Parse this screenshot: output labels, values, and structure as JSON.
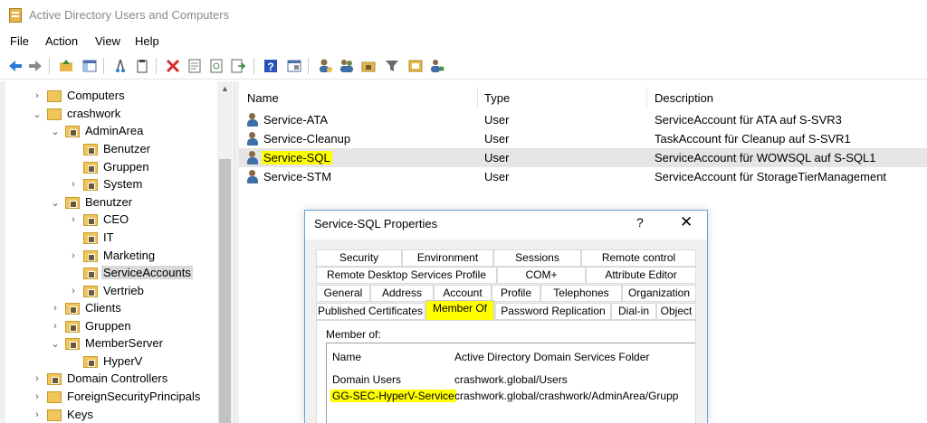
{
  "window": {
    "title": "Active Directory Users and Computers",
    "icon": "aduc-icon"
  },
  "menu": [
    "File",
    "Action",
    "View",
    "Help"
  ],
  "toolbar": {
    "icons": [
      "back-icon",
      "forward-icon",
      "up-folder-icon",
      "show-tree-icon",
      "cut-icon",
      "copy-icon",
      "delete-icon",
      "properties-icon",
      "refresh-icon",
      "export-icon",
      "help-icon",
      "console-icon",
      "new-user-icon",
      "new-group-icon",
      "new-ou-icon",
      "filter-icon",
      "add-to-group-icon",
      "delegate-icon"
    ]
  },
  "tree": {
    "items": [
      {
        "label": "Computers",
        "chevron": "›",
        "folder": "plain"
      },
      {
        "label": "crashwork",
        "chevron": "⌄",
        "folder": "plain"
      },
      {
        "label": "AdminArea",
        "chevron": "⌄",
        "folder": "ou"
      },
      {
        "label": "Benutzer",
        "chevron": "",
        "folder": "ou"
      },
      {
        "label": "Gruppen",
        "chevron": "",
        "folder": "ou"
      },
      {
        "label": "System",
        "chevron": "›",
        "folder": "ou"
      },
      {
        "label": "Benutzer",
        "chevron": "⌄",
        "folder": "ou"
      },
      {
        "label": "CEO",
        "chevron": "›",
        "folder": "ou"
      },
      {
        "label": "IT",
        "chevron": "",
        "folder": "ou"
      },
      {
        "label": "Marketing",
        "chevron": "›",
        "folder": "ou"
      },
      {
        "label": "ServiceAccounts",
        "chevron": "",
        "folder": "ou",
        "selected": true
      },
      {
        "label": "Vertrieb",
        "chevron": "›",
        "folder": "ou"
      },
      {
        "label": "Clients",
        "chevron": "›",
        "folder": "ou"
      },
      {
        "label": "Gruppen",
        "chevron": "›",
        "folder": "ou"
      },
      {
        "label": "MemberServer",
        "chevron": "⌄",
        "folder": "ou"
      },
      {
        "label": "HyperV",
        "chevron": "",
        "folder": "ou"
      },
      {
        "label": "Domain Controllers",
        "chevron": "›",
        "folder": "ou"
      },
      {
        "label": "ForeignSecurityPrincipals",
        "chevron": "›",
        "folder": "plain"
      },
      {
        "label": "Keys",
        "chevron": "›",
        "folder": "plain"
      }
    ]
  },
  "list": {
    "columns": [
      "Name",
      "Type",
      "Description"
    ],
    "rows": [
      {
        "name": "Service-ATA",
        "type": "User",
        "description": "ServiceAccount für ATA auf S-SVR3"
      },
      {
        "name": "Service-Cleanup",
        "type": "User",
        "description": "TaskAccount für Cleanup auf S-SVR1"
      },
      {
        "name": "Service-SQL",
        "type": "User",
        "description": "ServiceAccount für WOWSQL auf S-SQL1",
        "highlighted": true
      },
      {
        "name": "Service-STM",
        "type": "User",
        "description": "ServiceAccount für StorageTierManagement"
      }
    ]
  },
  "dialog": {
    "title": "Service-SQL Properties",
    "help": "?",
    "close": "✕",
    "tab_rows": [
      [
        "Security",
        "Environment",
        "Sessions",
        "Remote control"
      ],
      [
        "Remote Desktop Services Profile",
        "COM+",
        "Attribute Editor"
      ],
      [
        "General",
        "Address",
        "Account",
        "Profile",
        "Telephones",
        "Organization"
      ],
      [
        "Published Certificates",
        "Member Of",
        "Password Replication",
        "Dial-in",
        "Object"
      ]
    ],
    "active_tab": "Member Of",
    "member_of_label": "Member of:",
    "member_columns": [
      "Name",
      "Active Directory Domain Services Folder"
    ],
    "members": [
      {
        "name": "Domain Users",
        "folder": "crashwork.global/Users"
      },
      {
        "name": "GG-SEC-HyperV-Service",
        "folder": "crashwork.global/crashwork/AdminArea/Grupp",
        "highlighted": true
      }
    ]
  },
  "colors": {
    "highlight": "#ffff00",
    "dialog_border": "#6aa0d8",
    "selection": "#d9d9d9"
  }
}
